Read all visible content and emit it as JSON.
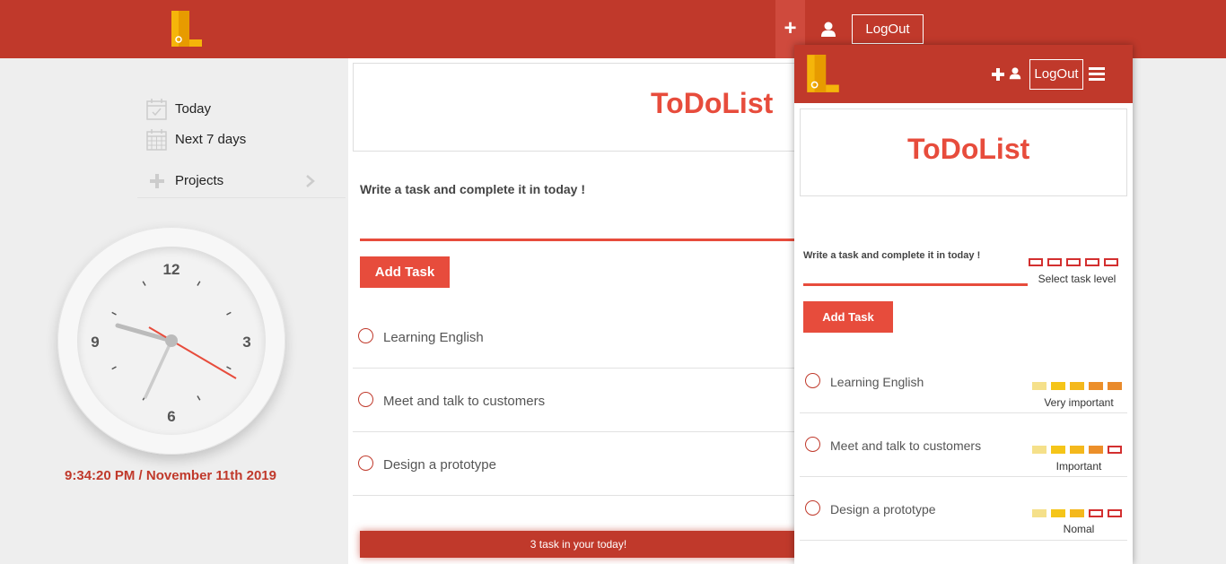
{
  "header": {
    "logout_label": "LogOut",
    "plus_icon": "+",
    "accent_color": "#c0392b"
  },
  "sidebar": {
    "items": [
      {
        "label": "Today",
        "icon": "calendar-check-icon"
      },
      {
        "label": "Next 7 days",
        "icon": "calendar-grid-icon"
      },
      {
        "label": "Projects",
        "icon": "plus-icon"
      }
    ]
  },
  "clock": {
    "numbers": [
      "12",
      "3",
      "6",
      "9"
    ],
    "datetime": "9:34:20 PM / November 11th 2019"
  },
  "main": {
    "title": "ToDoList",
    "prompt": "Write a task and complete it in today !",
    "add_task_label": "Add Task",
    "tasks": [
      {
        "label": "Learning English"
      },
      {
        "label": "Meet and talk to customers"
      },
      {
        "label": "Design a prototype"
      }
    ],
    "footer": "3 task in your today!"
  },
  "mobile": {
    "logout_label": "LogOut",
    "title": "ToDoList",
    "prompt": "Write a task and complete it in today !",
    "select_level_label": "Select task level",
    "add_task_label": "Add Task",
    "tasks": [
      {
        "label": "Learning English",
        "level": "Very important",
        "level_value": 5
      },
      {
        "label": "Meet and talk to customers",
        "level": "Important",
        "level_value": 4
      },
      {
        "label": "Design a prototype",
        "level": "Nomal",
        "level_value": 3
      }
    ],
    "level_colors": [
      "#f5e08a",
      "#f5c518",
      "#f4b81c",
      "#ec8f2a",
      "#e98a2b"
    ]
  }
}
